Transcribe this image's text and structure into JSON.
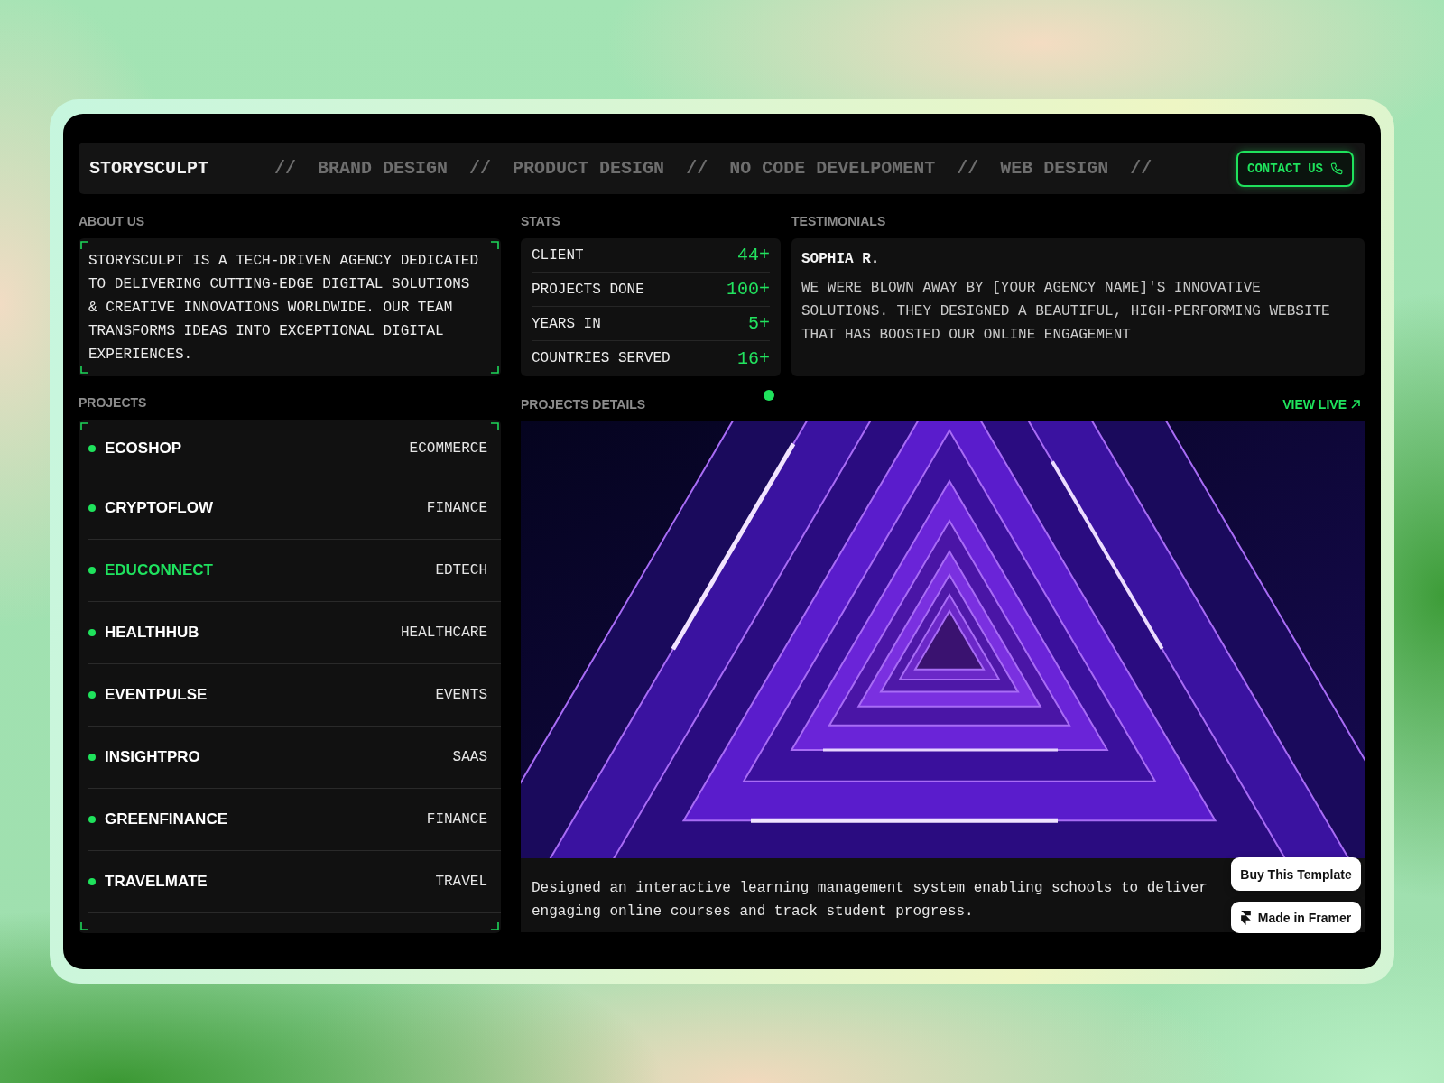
{
  "header": {
    "logo": "STORYSCULPT",
    "marquee": [
      "//",
      "BRAND DESIGN",
      "//",
      "PRODUCT DESIGN",
      "//",
      "NO CODE DEVELPOMENT",
      "//",
      "WEB DESIGN",
      "//"
    ],
    "contact_button": "CONTACT US"
  },
  "about": {
    "title": "ABOUT US",
    "text": "STORYSCULPT IS A TECH-DRIVEN AGENCY DEDICATED TO DELIVERING CUTTING-EDGE DIGITAL SOLUTIONS & CREATIVE INNOVATIONS WORLDWIDE. OUR TEAM TRANSFORMS IDEAS INTO EXCEPTIONAL DIGITAL EXPERIENCES."
  },
  "stats": {
    "title": "STATS",
    "rows": [
      {
        "label": "CLIENT",
        "value": "44+"
      },
      {
        "label": "PROJECTS DONE",
        "value": "100+"
      },
      {
        "label": "YEARS IN",
        "value": "5+"
      },
      {
        "label": "COUNTRIES SERVED",
        "value": "16+"
      }
    ]
  },
  "testimonials": {
    "title": "TESTIMONIALS",
    "items": [
      {
        "name": "SOPHIA R.",
        "quote": "WE WERE BLOWN AWAY BY [YOUR AGENCY NAME]'S INNOVATIVE SOLUTIONS. THEY DESIGNED A BEAUTIFUL, HIGH-PERFORMING WEBSITE THAT HAS BOOSTED OUR ONLINE ENGAGEMENT"
      }
    ]
  },
  "projects": {
    "title": "PROJECTS",
    "items": [
      {
        "name": "ECOSHOP",
        "category": "ECOMMERCE",
        "selected": false
      },
      {
        "name": "CRYPTOFLOW",
        "category": "FINANCE",
        "selected": false
      },
      {
        "name": "EDUCONNECT",
        "category": "EDTECH",
        "selected": true
      },
      {
        "name": "HEALTHHUB",
        "category": "HEALTHCARE",
        "selected": false
      },
      {
        "name": "EVENTPULSE",
        "category": "EVENTS",
        "selected": false
      },
      {
        "name": "INSIGHTPRO",
        "category": "SAAS",
        "selected": false
      },
      {
        "name": "GREENFINANCE",
        "category": "FINANCE",
        "selected": false
      },
      {
        "name": "TRAVELMATE",
        "category": "TRAVEL",
        "selected": false
      }
    ]
  },
  "project_details": {
    "title": "PROJECTS DETAILS",
    "link": "VIEW LIVE",
    "description": "Designed an interactive learning management system enabling schools to deliver engaging online courses and track student progress."
  },
  "overlay_buttons": [
    "Buy This Template",
    "Made in Framer"
  ]
}
